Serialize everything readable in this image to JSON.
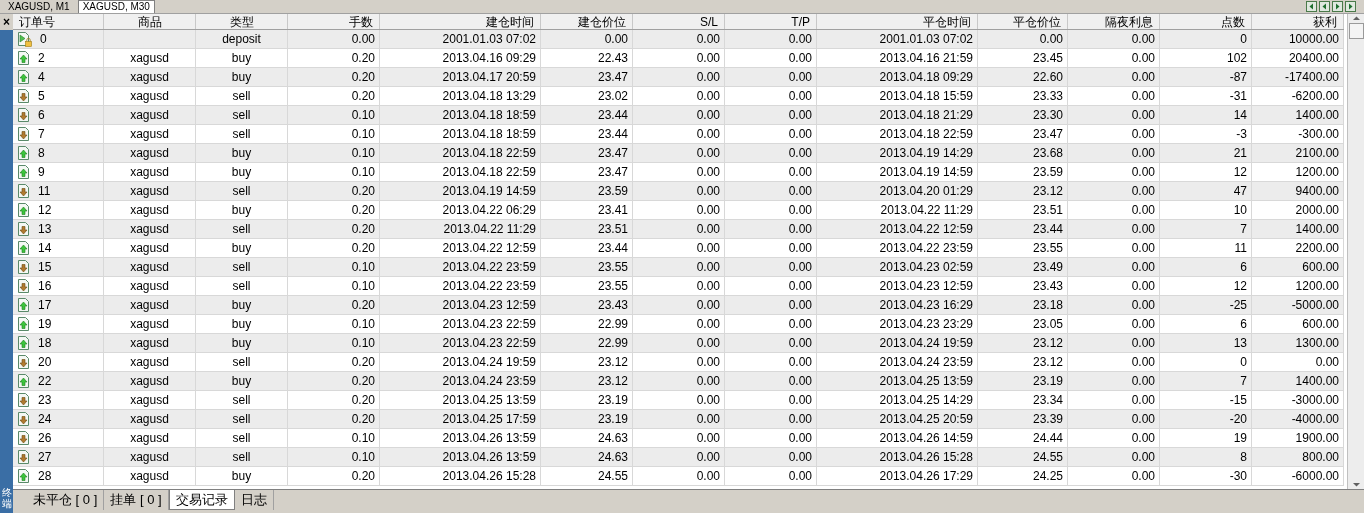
{
  "chart_tabs": [
    {
      "label": "XAGUSD, M1",
      "selected": false
    },
    {
      "label": "XAGUSD, M30",
      "selected": true
    }
  ],
  "side_panel": {
    "close": "×",
    "title": "终端"
  },
  "table": {
    "columns": [
      "订单号",
      "商品",
      "类型",
      "手数",
      "建仓时间",
      "建仓价位",
      "S/L",
      "T/P",
      "平仓时间",
      "平仓价位",
      "隔夜利息",
      "点数",
      "获利"
    ],
    "rows": [
      {
        "kind": "deposit",
        "cells": [
          "0",
          null,
          "deposit",
          "0.00",
          "2001.01.03 07:02",
          "0.00",
          "0.00",
          "0.00",
          "2001.01.03 07:02",
          "0.00",
          "0.00",
          "0",
          "10000.00"
        ]
      },
      {
        "kind": "buy",
        "cells": [
          "2",
          "xagusd",
          "buy",
          "0.20",
          "2013.04.16 09:29",
          "22.43",
          "0.00",
          "0.00",
          "2013.04.16 21:59",
          "23.45",
          "0.00",
          "102",
          "20400.00"
        ]
      },
      {
        "kind": "buy",
        "cells": [
          "4",
          "xagusd",
          "buy",
          "0.20",
          "2013.04.17 20:59",
          "23.47",
          "0.00",
          "0.00",
          "2013.04.18 09:29",
          "22.60",
          "0.00",
          "-87",
          "-17400.00"
        ]
      },
      {
        "kind": "sell",
        "cells": [
          "5",
          "xagusd",
          "sell",
          "0.20",
          "2013.04.18 13:29",
          "23.02",
          "0.00",
          "0.00",
          "2013.04.18 15:59",
          "23.33",
          "0.00",
          "-31",
          "-6200.00"
        ]
      },
      {
        "kind": "sell",
        "cells": [
          "6",
          "xagusd",
          "sell",
          "0.10",
          "2013.04.18 18:59",
          "23.44",
          "0.00",
          "0.00",
          "2013.04.18 21:29",
          "23.30",
          "0.00",
          "14",
          "1400.00"
        ]
      },
      {
        "kind": "sell",
        "cells": [
          "7",
          "xagusd",
          "sell",
          "0.10",
          "2013.04.18 18:59",
          "23.44",
          "0.00",
          "0.00",
          "2013.04.18 22:59",
          "23.47",
          "0.00",
          "-3",
          "-300.00"
        ]
      },
      {
        "kind": "buy",
        "cells": [
          "8",
          "xagusd",
          "buy",
          "0.10",
          "2013.04.18 22:59",
          "23.47",
          "0.00",
          "0.00",
          "2013.04.19 14:29",
          "23.68",
          "0.00",
          "21",
          "2100.00"
        ]
      },
      {
        "kind": "buy",
        "cells": [
          "9",
          "xagusd",
          "buy",
          "0.10",
          "2013.04.18 22:59",
          "23.47",
          "0.00",
          "0.00",
          "2013.04.19 14:59",
          "23.59",
          "0.00",
          "12",
          "1200.00"
        ]
      },
      {
        "kind": "sell",
        "cells": [
          "11",
          "xagusd",
          "sell",
          "0.20",
          "2013.04.19 14:59",
          "23.59",
          "0.00",
          "0.00",
          "2013.04.20 01:29",
          "23.12",
          "0.00",
          "47",
          "9400.00"
        ]
      },
      {
        "kind": "buy",
        "cells": [
          "12",
          "xagusd",
          "buy",
          "0.20",
          "2013.04.22 06:29",
          "23.41",
          "0.00",
          "0.00",
          "2013.04.22 11:29",
          "23.51",
          "0.00",
          "10",
          "2000.00"
        ]
      },
      {
        "kind": "sell",
        "cells": [
          "13",
          "xagusd",
          "sell",
          "0.20",
          "2013.04.22 11:29",
          "23.51",
          "0.00",
          "0.00",
          "2013.04.22 12:59",
          "23.44",
          "0.00",
          "7",
          "1400.00"
        ]
      },
      {
        "kind": "buy",
        "cells": [
          "14",
          "xagusd",
          "buy",
          "0.20",
          "2013.04.22 12:59",
          "23.44",
          "0.00",
          "0.00",
          "2013.04.22 23:59",
          "23.55",
          "0.00",
          "11",
          "2200.00"
        ]
      },
      {
        "kind": "sell",
        "cells": [
          "15",
          "xagusd",
          "sell",
          "0.10",
          "2013.04.22 23:59",
          "23.55",
          "0.00",
          "0.00",
          "2013.04.23 02:59",
          "23.49",
          "0.00",
          "6",
          "600.00"
        ]
      },
      {
        "kind": "sell",
        "cells": [
          "16",
          "xagusd",
          "sell",
          "0.10",
          "2013.04.22 23:59",
          "23.55",
          "0.00",
          "0.00",
          "2013.04.23 12:59",
          "23.43",
          "0.00",
          "12",
          "1200.00"
        ]
      },
      {
        "kind": "buy",
        "cells": [
          "17",
          "xagusd",
          "buy",
          "0.20",
          "2013.04.23 12:59",
          "23.43",
          "0.00",
          "0.00",
          "2013.04.23 16:29",
          "23.18",
          "0.00",
          "-25",
          "-5000.00"
        ]
      },
      {
        "kind": "buy",
        "cells": [
          "19",
          "xagusd",
          "buy",
          "0.10",
          "2013.04.23 22:59",
          "22.99",
          "0.00",
          "0.00",
          "2013.04.23 23:29",
          "23.05",
          "0.00",
          "6",
          "600.00"
        ]
      },
      {
        "kind": "buy",
        "cells": [
          "18",
          "xagusd",
          "buy",
          "0.10",
          "2013.04.23 22:59",
          "22.99",
          "0.00",
          "0.00",
          "2013.04.24 19:59",
          "23.12",
          "0.00",
          "13",
          "1300.00"
        ]
      },
      {
        "kind": "sell",
        "cells": [
          "20",
          "xagusd",
          "sell",
          "0.20",
          "2013.04.24 19:59",
          "23.12",
          "0.00",
          "0.00",
          "2013.04.24 23:59",
          "23.12",
          "0.00",
          "0",
          "0.00"
        ]
      },
      {
        "kind": "buy",
        "cells": [
          "22",
          "xagusd",
          "buy",
          "0.20",
          "2013.04.24 23:59",
          "23.12",
          "0.00",
          "0.00",
          "2013.04.25 13:59",
          "23.19",
          "0.00",
          "7",
          "1400.00"
        ]
      },
      {
        "kind": "sell",
        "cells": [
          "23",
          "xagusd",
          "sell",
          "0.20",
          "2013.04.25 13:59",
          "23.19",
          "0.00",
          "0.00",
          "2013.04.25 14:29",
          "23.34",
          "0.00",
          "-15",
          "-3000.00"
        ]
      },
      {
        "kind": "sell",
        "cells": [
          "24",
          "xagusd",
          "sell",
          "0.20",
          "2013.04.25 17:59",
          "23.19",
          "0.00",
          "0.00",
          "2013.04.25 20:59",
          "23.39",
          "0.00",
          "-20",
          "-4000.00"
        ]
      },
      {
        "kind": "sell",
        "cells": [
          "26",
          "xagusd",
          "sell",
          "0.10",
          "2013.04.26 13:59",
          "24.63",
          "0.00",
          "0.00",
          "2013.04.26 14:59",
          "24.44",
          "0.00",
          "19",
          "1900.00"
        ]
      },
      {
        "kind": "sell",
        "cells": [
          "27",
          "xagusd",
          "sell",
          "0.10",
          "2013.04.26 13:59",
          "24.63",
          "0.00",
          "0.00",
          "2013.04.26 15:28",
          "24.55",
          "0.00",
          "8",
          "800.00"
        ]
      },
      {
        "kind": "buy",
        "cells": [
          "28",
          "xagusd",
          "buy",
          "0.20",
          "2013.04.26 15:28",
          "24.55",
          "0.00",
          "0.00",
          "2013.04.26 17:29",
          "24.25",
          "0.00",
          "-30",
          "-6000.00"
        ]
      }
    ]
  },
  "bottom_tabs": [
    {
      "label": "未平仓 [ 0 ]",
      "selected": false
    },
    {
      "label": "挂单 [ 0 ]",
      "selected": false
    },
    {
      "label": "交易记录",
      "selected": true
    },
    {
      "label": "日志",
      "selected": false
    }
  ]
}
